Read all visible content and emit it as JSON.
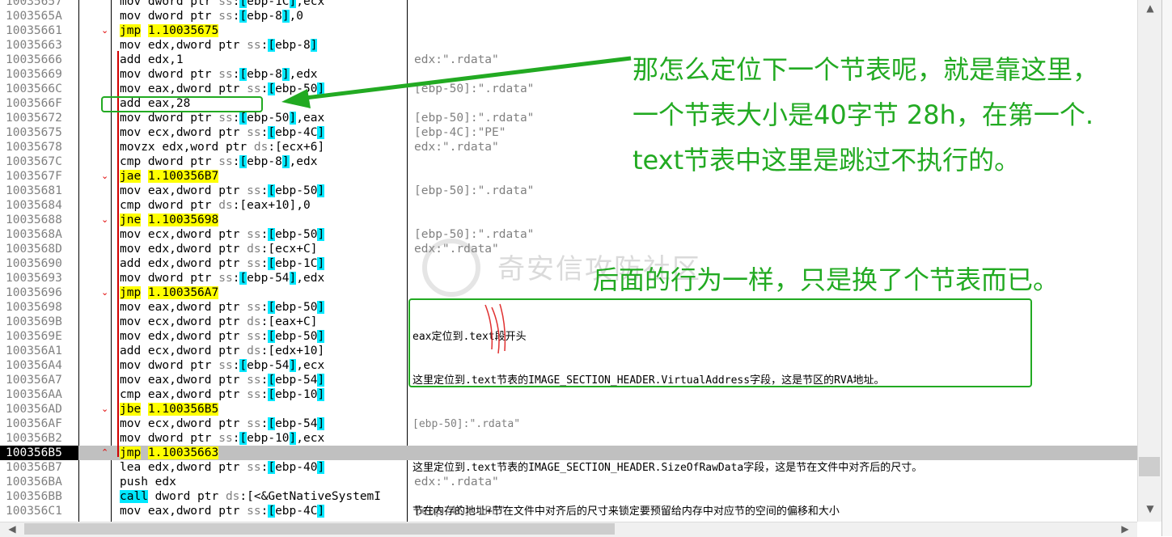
{
  "disasm": {
    "rows": [
      {
        "addr": "10035657",
        "instr": "mov dword ptr ss:[ebp-1C],ecx",
        "comment": ""
      },
      {
        "addr": "1003565A",
        "instr": "mov dword ptr ss:[ebp-8],0",
        "comment": ""
      },
      {
        "addr": "10035661",
        "instr": "jmp 1.10035675",
        "comment": ""
      },
      {
        "addr": "10035663",
        "instr": "mov edx,dword ptr ss:[ebp-8]",
        "comment": ""
      },
      {
        "addr": "10035666",
        "instr": "add edx,1",
        "comment": "edx:\".rdata\""
      },
      {
        "addr": "10035669",
        "instr": "mov dword ptr ss:[ebp-8],edx",
        "comment": ""
      },
      {
        "addr": "1003566C",
        "instr": "mov eax,dword ptr ss:[ebp-50]",
        "comment": "[ebp-50]:\".rdata\""
      },
      {
        "addr": "1003566F",
        "instr": "add eax,28",
        "comment": ""
      },
      {
        "addr": "10035672",
        "instr": "mov dword ptr ss:[ebp-50],eax",
        "comment": "[ebp-50]:\".rdata\""
      },
      {
        "addr": "10035675",
        "instr": "mov ecx,dword ptr ss:[ebp-4C]",
        "comment": "[ebp-4C]:\"PE\""
      },
      {
        "addr": "10035678",
        "instr": "movzx edx,word ptr ds:[ecx+6]",
        "comment": "edx:\".rdata\""
      },
      {
        "addr": "1003567C",
        "instr": "cmp dword ptr ss:[ebp-8],edx",
        "comment": ""
      },
      {
        "addr": "1003567F",
        "instr": "jae 1.100356B7",
        "comment": ""
      },
      {
        "addr": "10035681",
        "instr": "mov eax,dword ptr ss:[ebp-50]",
        "comment": "[ebp-50]:\".rdata\""
      },
      {
        "addr": "10035684",
        "instr": "cmp dword ptr ds:[eax+10],0",
        "comment": ""
      },
      {
        "addr": "10035688",
        "instr": "jne 1.10035698",
        "comment": ""
      },
      {
        "addr": "1003568A",
        "instr": "mov ecx,dword ptr ss:[ebp-50]",
        "comment": "[ebp-50]:\".rdata\""
      },
      {
        "addr": "1003568D",
        "instr": "mov edx,dword ptr ds:[ecx+C]",
        "comment": "edx:\".rdata\""
      },
      {
        "addr": "10035690",
        "instr": "add edx,dword ptr ss:[ebp-1C]",
        "comment": ""
      },
      {
        "addr": "10035693",
        "instr": "mov dword ptr ss:[ebp-54],edx",
        "comment": ""
      },
      {
        "addr": "10035696",
        "instr": "jmp 1.100356A7",
        "comment": ""
      },
      {
        "addr": "10035698",
        "instr": "mov eax,dword ptr ss:[ebp-50]",
        "comment": ""
      },
      {
        "addr": "1003569B",
        "instr": "mov ecx,dword ptr ds:[eax+C]",
        "comment": ""
      },
      {
        "addr": "1003569E",
        "instr": "mov edx,dword ptr ss:[ebp-50]",
        "comment": ""
      },
      {
        "addr": "100356A1",
        "instr": "add ecx,dword ptr ds:[edx+10]",
        "comment": ""
      },
      {
        "addr": "100356A4",
        "instr": "mov dword ptr ss:[ebp-54],ecx",
        "comment": ""
      },
      {
        "addr": "100356A7",
        "instr": "mov eax,dword ptr ss:[ebp-54]",
        "comment": ""
      },
      {
        "addr": "100356AA",
        "instr": "cmp eax,dword ptr ss:[ebp-10]",
        "comment": ""
      },
      {
        "addr": "100356AD",
        "instr": "jbe 1.100356B5",
        "comment": ""
      },
      {
        "addr": "100356AF",
        "instr": "mov ecx,dword ptr ss:[ebp-54]",
        "comment": ""
      },
      {
        "addr": "100356B2",
        "instr": "mov dword ptr ss:[ebp-10],ecx",
        "comment": ""
      },
      {
        "addr": "100356B5",
        "instr": "jmp 1.10035663",
        "comment": ""
      },
      {
        "addr": "100356B7",
        "instr": "lea edx,dword ptr ss:[ebp-40]",
        "comment": ""
      },
      {
        "addr": "100356BA",
        "instr": "push edx",
        "comment": "edx:\".rdata\""
      },
      {
        "addr": "100356BB",
        "instr": "call dword ptr ds:[<&GetNativeSystemI",
        "comment": ""
      },
      {
        "addr": "100356C1",
        "instr": "mov eax,dword ptr ss:[ebp-4C]",
        "comment": "[ebp-4C]:\"PE\""
      }
    ],
    "selected_addr": "100356B5"
  },
  "annotations": {
    "top_note_line1": "那怎么定位下一个节表呢，就是靠这里，",
    "top_note_line2": "一个节表大小是40字节 28h，在第一个.",
    "top_note_line3": "text节表中这里是跳过不执行的。",
    "middle_note": "后面的行为一样，只是换了个节表而已。",
    "box_line1": "eax定位到.text段开头",
    "box_line2": "这里定位到.text节表的IMAGE_SECTION_HEADER.VirtualAddress字段，这是节区的RVA地址。",
    "box_line3": "[ebp-50]:\".rdata\"",
    "box_line4": "这里定位到.text节表的IMAGE_SECTION_HEADER.SizeOfRawData字段，这是节在文件中对齐后的尺寸。",
    "box_line5": "节在内存的地址+节在文件中对齐后的尺寸来锁定要预留给内存中对应节的空间的偏移和大小"
  },
  "watermark": "奇安信攻防社区",
  "colors": {
    "annotation": "#22aa22",
    "jump_highlight": "#ffff00",
    "register_highlight": "#00e8ff",
    "arrow": "#e00000"
  },
  "icons": {
    "scroll_up": "triangle-up",
    "scroll_down": "triangle-down",
    "scroll_left": "triangle-left",
    "scroll_right": "triangle-right"
  }
}
